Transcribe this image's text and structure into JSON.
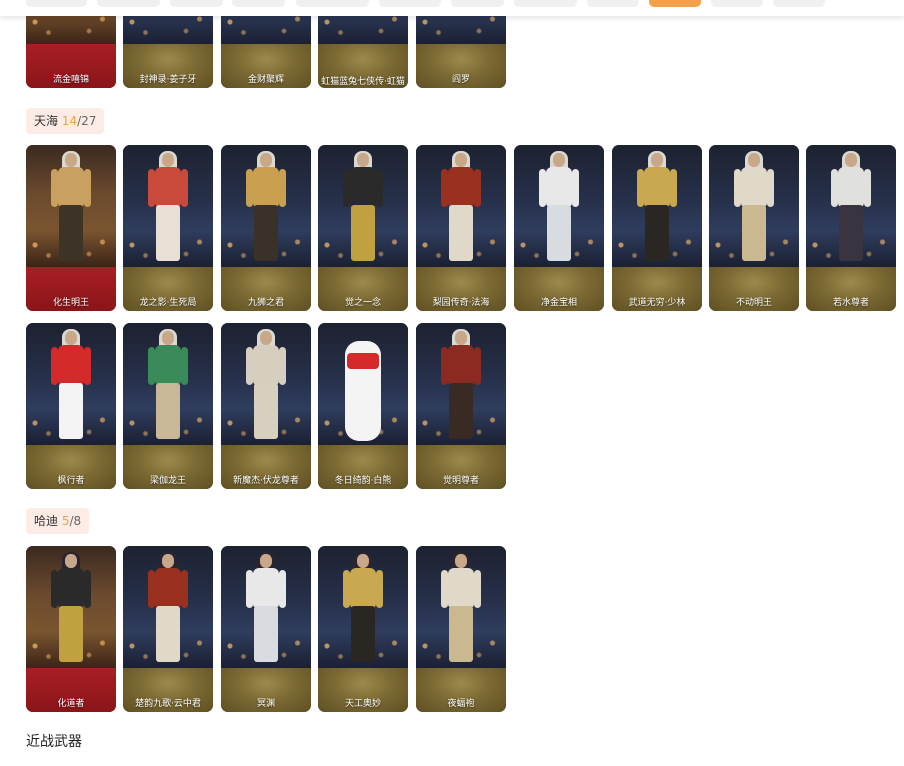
{
  "top_tabs": [
    "",
    "",
    "",
    "",
    "",
    "",
    "",
    "",
    "",
    "",
    "",
    "",
    ""
  ],
  "groups": [
    {
      "items": [
        {
          "name": "流金嘻锦",
          "selected": true
        },
        {
          "name": "封神录·姜子牙"
        },
        {
          "name": "金财聚辉"
        },
        {
          "name": "虹猫蓝兔七侠传·虹猫"
        },
        {
          "name": "阎罗"
        }
      ]
    },
    {
      "label": "天海",
      "owned": "14",
      "sep": "/",
      "total": "27",
      "items": [
        {
          "name": "化生明王",
          "selected": true
        },
        {
          "name": "龙之影·生死局"
        },
        {
          "name": "九狮之君"
        },
        {
          "name": "觉之一念"
        },
        {
          "name": "梨园传奇·法海"
        },
        {
          "name": "净金宝相"
        },
        {
          "name": "武道无穷·少林"
        },
        {
          "name": "不动明王"
        },
        {
          "name": "若水尊者"
        },
        {
          "name": "枫行者"
        },
        {
          "name": "梁伽龙王"
        },
        {
          "name": "新魔杰·伏龙尊者"
        },
        {
          "name": "冬日绮韵·白熊"
        },
        {
          "name": "觉明尊者"
        }
      ]
    },
    {
      "label": "哈迪",
      "owned": "5",
      "sep": "/",
      "total": "8",
      "items": [
        {
          "name": "化道者",
          "selected": true
        },
        {
          "name": "楚韵九歌·云中君"
        },
        {
          "name": "冥渊"
        },
        {
          "name": "天工奥妙"
        },
        {
          "name": "夜蝠袍"
        }
      ]
    }
  ],
  "next_section": "近战武器",
  "colors": {
    "accent_tab": "#f5a04a",
    "selected_card": "#a81f25",
    "owned_count": "#f0a050",
    "group_tag_bg": "#fdebe5"
  }
}
